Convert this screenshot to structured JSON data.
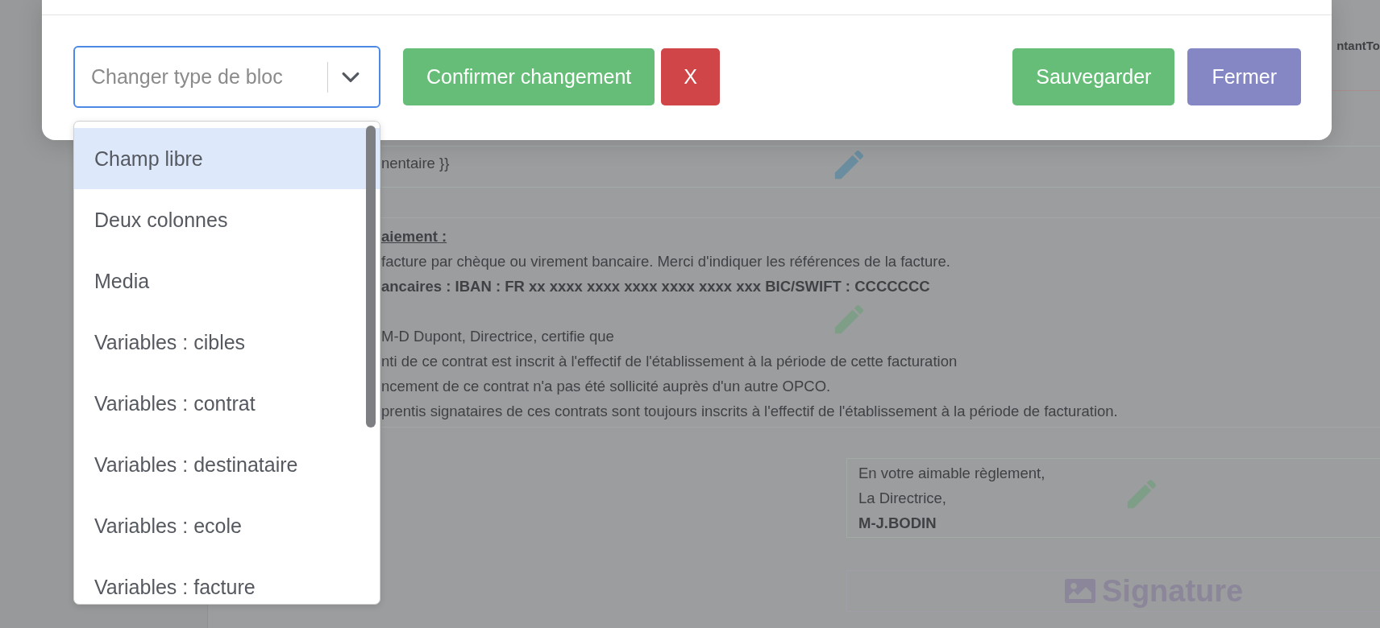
{
  "modal": {
    "select": {
      "placeholder": "Changer type de bloc"
    },
    "buttons": [
      {
        "label": "Confirmer changement",
        "kind": "success"
      },
      {
        "label": "X",
        "kind": "danger"
      },
      {
        "label": "Sauvegarder",
        "kind": "success"
      },
      {
        "label": "Fermer",
        "kind": "secondary"
      }
    ]
  },
  "dropdown": {
    "options": [
      {
        "label": "Champ libre",
        "selected": true
      },
      {
        "label": "Deux colonnes",
        "selected": false
      },
      {
        "label": "Media",
        "selected": false
      },
      {
        "label": "Variables : cibles",
        "selected": false
      },
      {
        "label": "Variables : contrat",
        "selected": false
      },
      {
        "label": "Variables : destinataire",
        "selected": false
      },
      {
        "label": "Variables : ecole",
        "selected": false
      },
      {
        "label": "Variables : facture",
        "selected": false
      }
    ]
  },
  "background": {
    "header_text": "ntantTo",
    "blocks": [
      {
        "kind": "variable",
        "paragraphs": [
          [
            {
              "text": "nentaire }}",
              "kind": "normal"
            }
          ]
        ]
      },
      {
        "kind": "text",
        "paragraphs": [
          [
            {
              "text": "aiement :",
              "kind": "heading"
            },
            {
              "text": "facture par chèque ou virement bancaire. Merci d'indiquer les références de la facture.",
              "kind": "normal"
            },
            {
              "text": "ancaires : IBAN : FR xx xxxx xxxx xxxx xxxx xxxx xxx BIC/SWIFT : CCCCCCC",
              "kind": "bold"
            }
          ],
          [
            {
              "text": "M-D Dupont, Directrice, certifie que",
              "kind": "normal"
            },
            {
              "text": "nti de ce contrat est inscrit à l'effectif de l'établissement à la période de cette facturation",
              "kind": "normal"
            },
            {
              "text": "ncement de ce contrat n'a pas été sollicité auprès d'un autre OPCO.",
              "kind": "normal"
            },
            {
              "text": "prentis signataires de ces contrats sont toujours inscrits à l'effectif de l'établissement à la période de facturation.",
              "kind": "normal"
            }
          ]
        ]
      },
      {
        "kind": "closing",
        "paragraphs": [
          [
            {
              "text": "En votre aimable règlement,",
              "kind": "normal"
            },
            {
              "text": "La Directrice,",
              "kind": "normal"
            },
            {
              "text": "M-J.BODIN",
              "kind": "bold"
            }
          ]
        ]
      },
      {
        "kind": "image",
        "label": "Signature"
      }
    ]
  }
}
